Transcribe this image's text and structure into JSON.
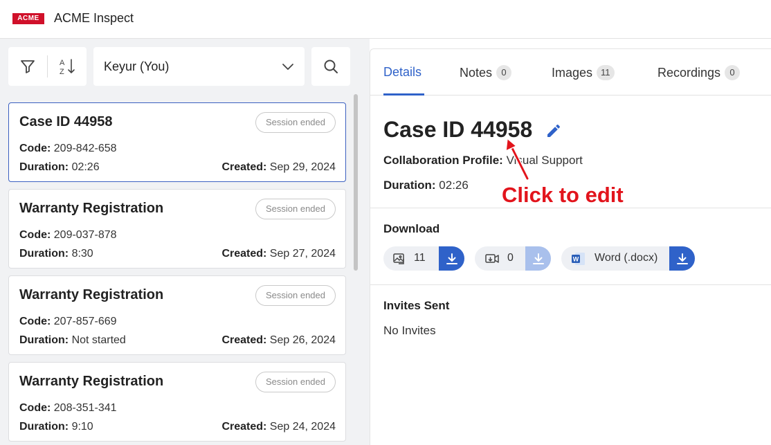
{
  "header": {
    "logo_text": "ACME",
    "app_title": "ACME Inspect"
  },
  "toolbar": {
    "user_select_value": "Keyur (You)"
  },
  "cases": [
    {
      "title": "Case ID 44958",
      "status": "Session ended",
      "code_label": "Code:",
      "code": "209-842-658",
      "duration_label": "Duration:",
      "duration": "02:26",
      "created_label": "Created:",
      "created": "Sep 29, 2024",
      "selected": true
    },
    {
      "title": "Warranty Registration",
      "status": "Session ended",
      "code_label": "Code:",
      "code": "209-037-878",
      "duration_label": "Duration:",
      "duration": "8:30",
      "created_label": "Created:",
      "created": "Sep 27, 2024",
      "selected": false
    },
    {
      "title": "Warranty Registration",
      "status": "Session ended",
      "code_label": "Code:",
      "code": "207-857-669",
      "duration_label": "Duration:",
      "duration": "Not started",
      "created_label": "Created:",
      "created": "Sep 26, 2024",
      "selected": false
    },
    {
      "title": "Warranty Registration",
      "status": "Session ended",
      "code_label": "Code:",
      "code": "208-351-341",
      "duration_label": "Duration:",
      "duration": "9:10",
      "created_label": "Created:",
      "created": "Sep 24, 2024",
      "selected": false
    }
  ],
  "tabs": [
    {
      "label": "Details",
      "count": null,
      "active": true
    },
    {
      "label": "Notes",
      "count": "0",
      "active": false
    },
    {
      "label": "Images",
      "count": "11",
      "active": false
    },
    {
      "label": "Recordings",
      "count": "0",
      "active": false
    }
  ],
  "details": {
    "title": "Case ID 44958",
    "profile_label": "Collaboration Profile:",
    "profile_value": "Visual Support",
    "duration_label": "Duration:",
    "duration_value": "02:26",
    "download_title": "Download",
    "downloads": {
      "images_count": "11",
      "recordings_count": "0",
      "word_label": "Word (.docx)"
    },
    "invites_title": "Invites Sent",
    "invites_value": "No Invites"
  },
  "annotation": {
    "text": "Click to edit"
  },
  "colors": {
    "accent": "#2f62c9",
    "logo": "#d0102a",
    "annotation": "#e2141c"
  },
  "icons": [
    "filter-icon",
    "sort-az-icon",
    "chevron-down-icon",
    "search-icon",
    "pencil-icon",
    "image-icon",
    "recording-icon",
    "word-doc-icon",
    "download-icon"
  ]
}
